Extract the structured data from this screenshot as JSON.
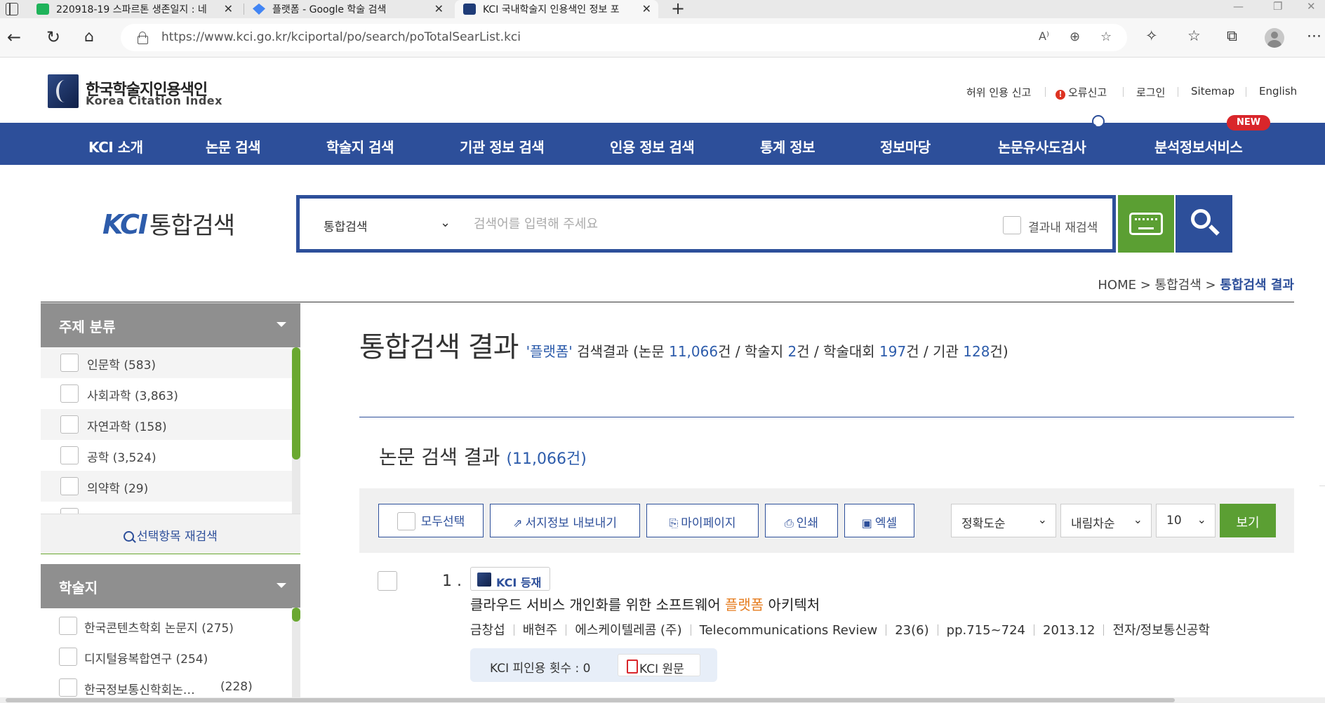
{
  "browser": {
    "tabs": [
      {
        "title": "220918-19 스파르톤 생존일지 : 네",
        "favicon_color": "#1fb35a"
      },
      {
        "title": "플랫폼 - Google 학술 검색",
        "favicon_color": "#4285f4"
      },
      {
        "title": "KCI 국내학술지 인용색인 정보 포",
        "favicon_color": "#1f3c78"
      }
    ],
    "url": "https://www.kci.go.kr/kciportal/po/search/poTotalSearList.kci"
  },
  "site": {
    "logo_ko": "한국학술지인용색인",
    "logo_en": "Korea Citation Index",
    "util_links": [
      "허위 인용 신고",
      "오류신고",
      "로그인",
      "Sitemap",
      "English"
    ],
    "gnb": [
      "KCI 소개",
      "논문 검색",
      "학술지 검색",
      "기관 정보 검색",
      "인용 정보 검색",
      "통계 정보",
      "정보마당",
      "논문유사도검사",
      "분석정보서비스"
    ],
    "gnb_new_badge": "NEW"
  },
  "search": {
    "brand_k": "KCI",
    "brand_title": "통합검색",
    "scope": "통합검색",
    "placeholder": "검색어를 입력해 주세요",
    "research_label": "결과내 재검색"
  },
  "breadcrumb": {
    "home": "HOME",
    "mid": "통합검색",
    "current": "통합검색 결과",
    "sep": ">"
  },
  "sidebar": {
    "subject": {
      "title": "주제 분류",
      "items": [
        {
          "label": "인문학 (583)"
        },
        {
          "label": "사회과학 (3,863)"
        },
        {
          "label": "자연과학 (158)"
        },
        {
          "label": "공학 (3,524)"
        },
        {
          "label": "의약학 (29)"
        }
      ]
    },
    "research_btn": "선택항목 재검색",
    "journal": {
      "title": "학술지",
      "items": [
        {
          "label": "한국콘텐츠학회 논문지",
          "count": "(275)"
        },
        {
          "label": "디지털융복합연구",
          "count": "(254)"
        },
        {
          "label": "한국정보통신학회논…",
          "count": "(228)"
        }
      ]
    }
  },
  "results": {
    "title": "통합검색 결과",
    "query": "'플랫폼'",
    "summary": {
      "a": "검색결과 (논문 ",
      "paper_count": "11,066",
      "b": "건 / 학술지 ",
      "journal_count": "2",
      "c": "건 / 학술대회 ",
      "conf_count": "197",
      "d": "건 / 기관 ",
      "inst_count": "128",
      "e": "건)"
    },
    "paper_section_title": "논문 검색 결과",
    "paper_section_count": "(11,066건)",
    "toolbar": {
      "select_all": "모두선택",
      "export": "서지정보 내보내기",
      "mypage": "마이페이지",
      "print": "인쇄",
      "excel": "엑셀",
      "sort_field": "정확도순",
      "sort_order": "내림차순",
      "page_size": "10",
      "view": "보기"
    },
    "items": [
      {
        "num": "1 .",
        "badge": "KCI 등재",
        "title_pre": "클라우드 서비스 개인화를 위한 소프트웨어 ",
        "title_kw": "플랫폼",
        "title_post": " 아키텍처",
        "authors": [
          "금창섭",
          "배현주"
        ],
        "publisher": "에스케이텔레콤 (주)",
        "journal": "Telecommunications Review",
        "volume": "23(6)",
        "pages": "pp.715~724",
        "date": "2013.12",
        "field": "전자/정보통신공학",
        "citations": "KCI 피인용 횟수 : 0",
        "pdf_label": "KCI 원문"
      }
    ]
  }
}
